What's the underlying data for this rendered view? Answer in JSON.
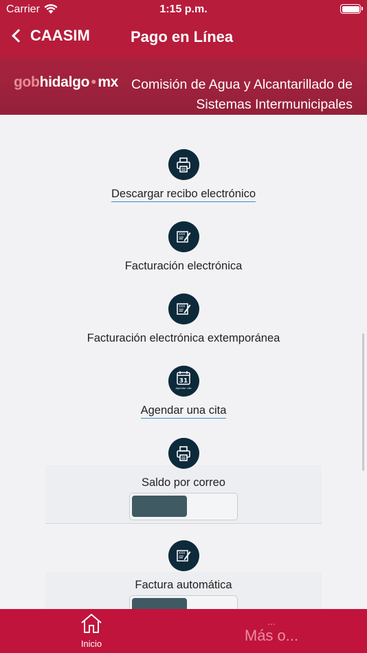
{
  "status_bar": {
    "carrier": "Carrier",
    "time": "1:15 p.m."
  },
  "nav": {
    "back_label": "CAASIM",
    "title": "Pago en Línea"
  },
  "banner": {
    "logo_gob": "gob",
    "logo_hidalgo": "hidalgo",
    "logo_dot": "●",
    "logo_mx": "mx",
    "org_name": "Comisión de Agua y Alcantarillado de Sistemas Intermunicipales"
  },
  "items": [
    {
      "label": "Descargar recibo electrónico",
      "icon": "printer-icon"
    },
    {
      "label": "Facturación electrónica",
      "icon": "invoice-icon"
    },
    {
      "label": "Facturación electrónica extemporánea",
      "icon": "invoice-icon"
    },
    {
      "label": "Agendar una cita",
      "icon": "calendar-icon",
      "icon_day": "31",
      "icon_caption": "Agendar cita"
    },
    {
      "label": "Saldo por correo",
      "icon": "printer-icon"
    },
    {
      "label": "Factura automática",
      "icon": "invoice-icon"
    }
  ],
  "tabbar": {
    "home_label": "Inicio",
    "more_dots": "...",
    "more_label": "Más o..."
  },
  "colors": {
    "header": "#b71c3b",
    "banner": "#a8233f",
    "icon_circle": "#0d2a3b",
    "tabbar": "#c1143c",
    "switch_knob": "#3f5a63",
    "link_underline": "#3a8fc8"
  }
}
